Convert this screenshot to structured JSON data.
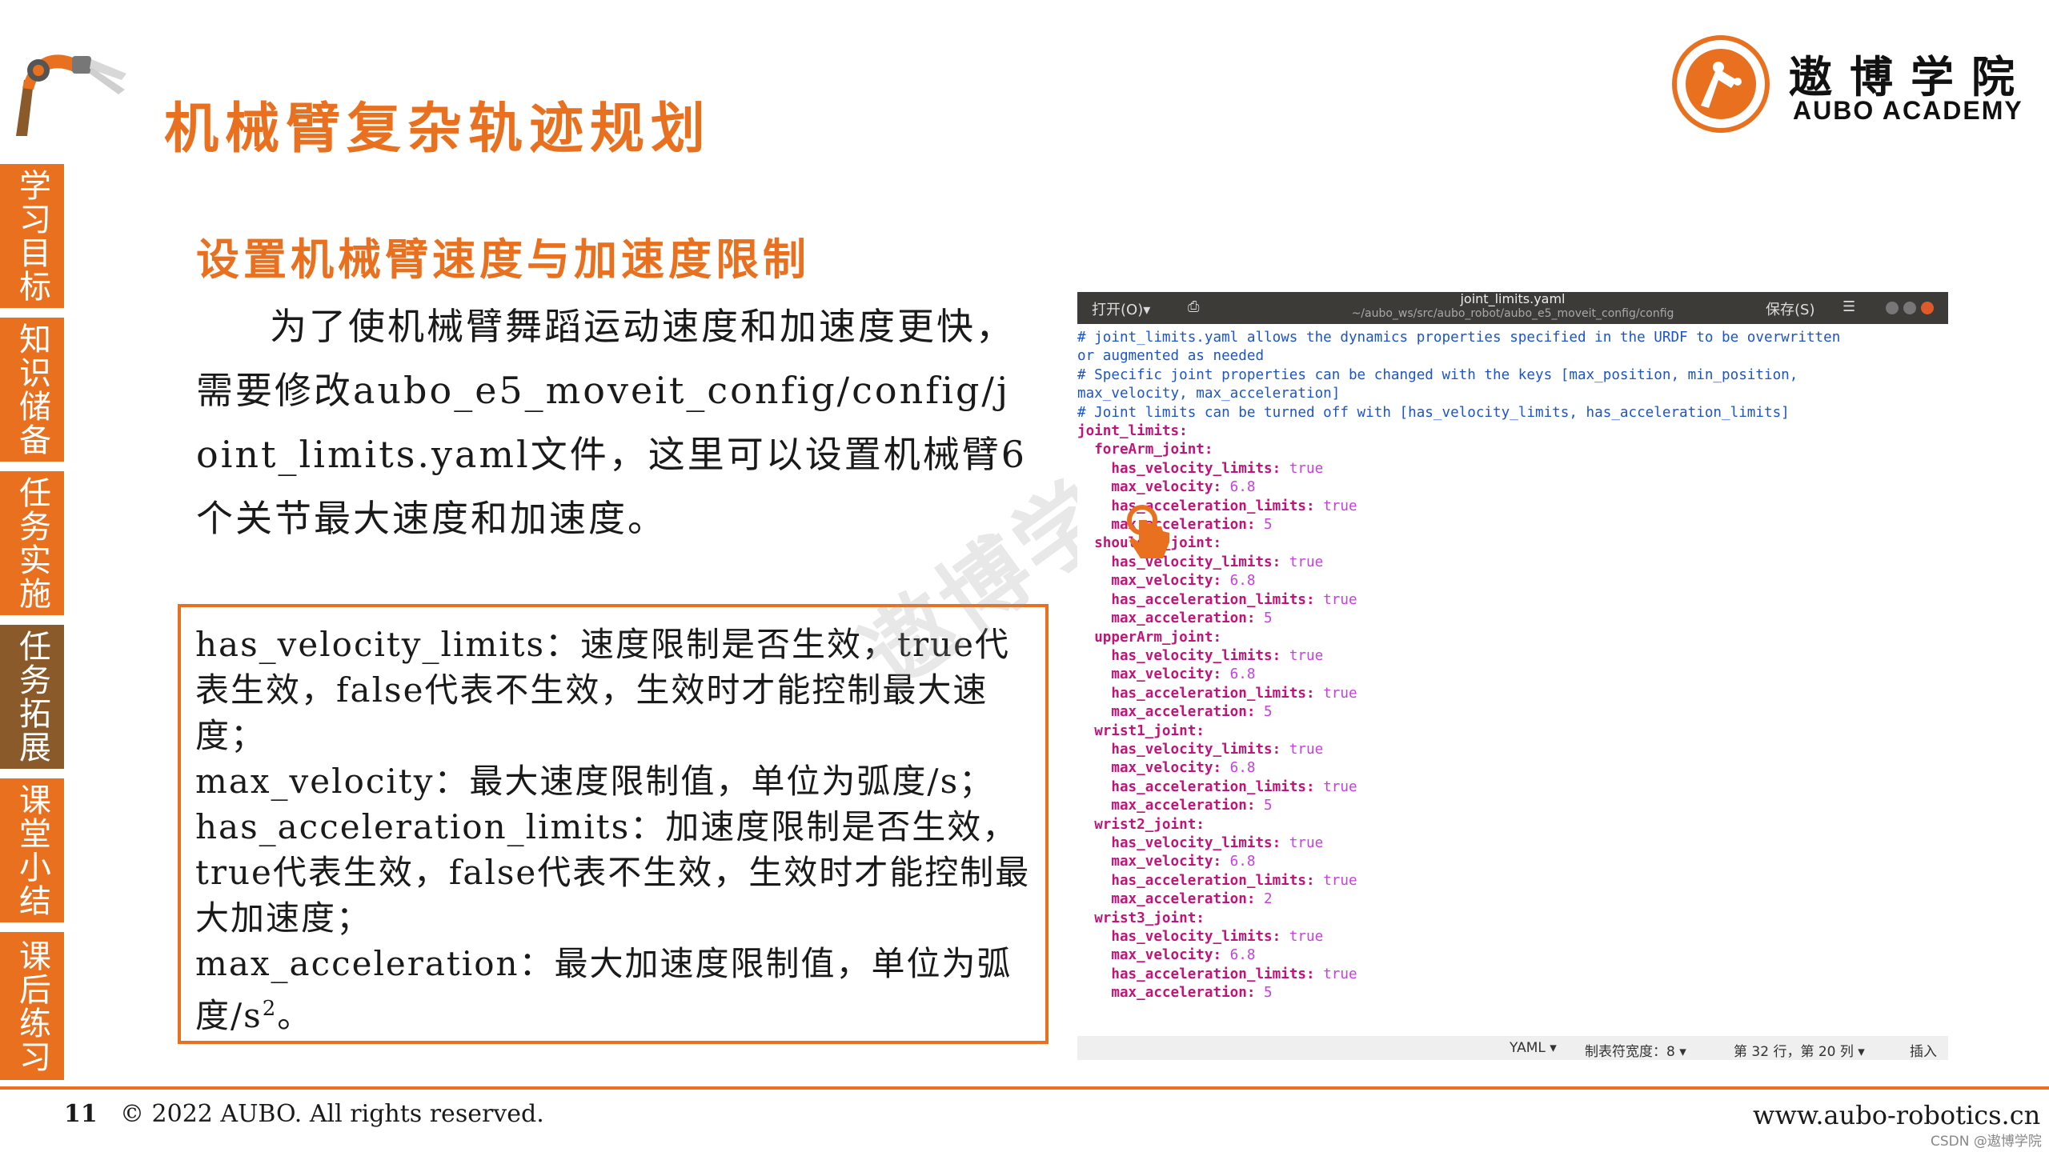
{
  "title": "机械臂复杂轨迹规划",
  "brand": {
    "name_cn": "遨博学院",
    "name_en": "AUBO ACADEMY",
    "logo_text": "AUBO ACADEMY",
    "accent": "#e8701f"
  },
  "sidebar": {
    "items": [
      {
        "label": "学习目标"
      },
      {
        "label": "知识储备"
      },
      {
        "label": "任务实施"
      },
      {
        "label": "任务拓展"
      },
      {
        "label": "课堂小结"
      },
      {
        "label": "课后练习"
      }
    ],
    "active": "任务拓展"
  },
  "section_title": "设置机械臂速度与加速度限制",
  "intro": "为了使机械臂舞蹈运动速度和加速度更快，需要修改aubo_e5_moveit_config/config/joint_limits.yaml文件，这里可以设置机械臂6个关节最大速度和加速度。",
  "info_box": {
    "p1": "has_velocity_limits：速度限制是否生效，true代表生效，false代表不生效，生效时才能控制最大速度；",
    "p2": "max_velocity：最大速度限制值，单位为弧度/s；",
    "p3": "has_acceleration_limits：加速度限制是否生效，true代表生效，false代表不生效，生效时才能控制最大加速度；",
    "p4_prefix": "max_acceleration：最大加速度限制值，单位为弧度/s",
    "p4_sup": "2",
    "p4_suffix": "。"
  },
  "editor": {
    "open_label": "打开(O)▾",
    "save_label": "保存(S)",
    "menu_label": "☰",
    "filename": "joint_limits.yaml",
    "path": "~/aubo_ws/src/aubo_robot/aubo_e5_moveit_config/config",
    "comments": [
      "# joint_limits.yaml allows the dynamics properties specified in the URDF to be overwritten",
      "or augmented as needed",
      "# Specific joint properties can be changed with the keys [max_position, min_position,",
      "max_velocity, max_acceleration]",
      "# Joint limits can be turned off with [has_velocity_limits, has_acceleration_limits]"
    ],
    "root_key": "joint_limits:",
    "joints": [
      {
        "name": "foreArm_joint",
        "has_velocity_limits": "true",
        "max_velocity": "6.8",
        "has_acceleration_limits": "true",
        "max_acceleration": "5"
      },
      {
        "name": "shoulder_joint",
        "has_velocity_limits": "true",
        "max_velocity": "6.8",
        "has_acceleration_limits": "true",
        "max_acceleration": "5"
      },
      {
        "name": "upperArm_joint",
        "has_velocity_limits": "true",
        "max_velocity": "6.8",
        "has_acceleration_limits": "true",
        "max_acceleration": "5"
      },
      {
        "name": "wrist1_joint",
        "has_velocity_limits": "true",
        "max_velocity": "6.8",
        "has_acceleration_limits": "true",
        "max_acceleration": "5"
      },
      {
        "name": "wrist2_joint",
        "has_velocity_limits": "true",
        "max_velocity": "6.8",
        "has_acceleration_limits": "true",
        "max_acceleration": "2"
      },
      {
        "name": "wrist3_joint",
        "has_velocity_limits": "true",
        "max_velocity": "6.8",
        "has_acceleration_limits": "true",
        "max_acceleration": "5"
      }
    ],
    "status": {
      "language": "YAML ▾",
      "tab_width": "制表符宽度：8 ▾",
      "position": "第 32 行，第 20 列 ▾",
      "mode": "插入"
    }
  },
  "watermark": "遨博学院",
  "footer": {
    "page_number": "11",
    "copyright": "© 2022 AUBO. All rights reserved.",
    "website": "www.aubo-robotics.cn",
    "csdn": "CSDN @遨博学院"
  }
}
